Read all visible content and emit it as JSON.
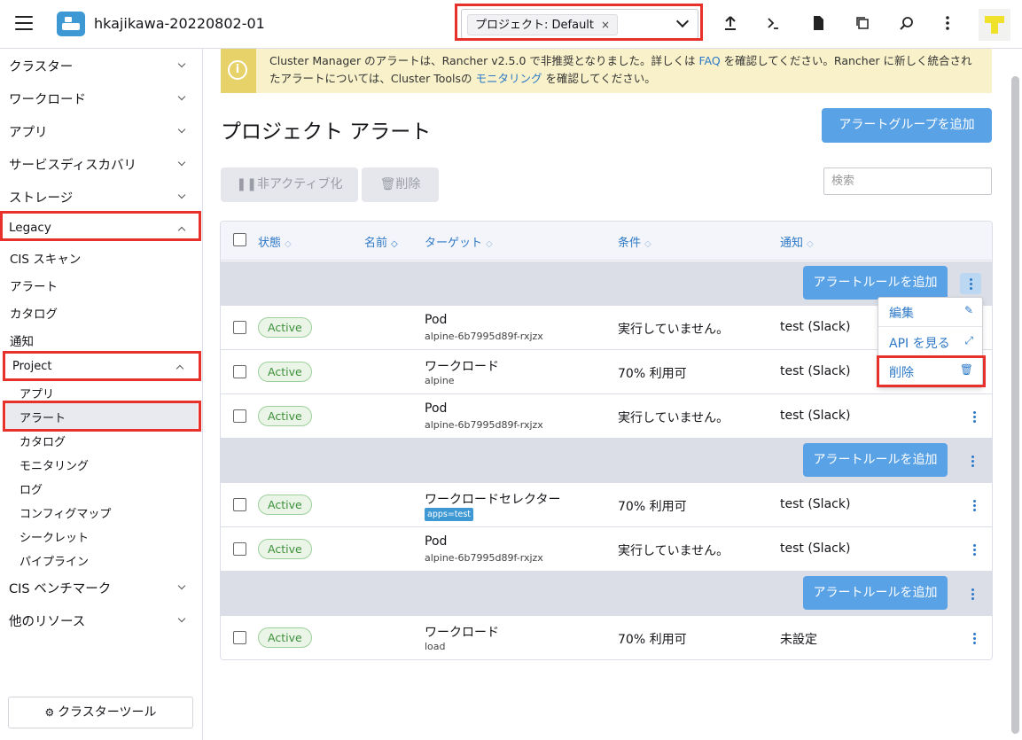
{
  "header": {
    "cluster_name": "hkajikawa-20220802-01",
    "project_chip": "プロジェクト: Default",
    "chip_close": "×"
  },
  "sidebar": {
    "groups": [
      {
        "label": "クラスター",
        "chevron": "down"
      },
      {
        "label": "ワークロード",
        "chevron": "down"
      },
      {
        "label": "アプリ",
        "chevron": "down"
      },
      {
        "label": "サービスディスカバリ",
        "chevron": "down"
      },
      {
        "label": "ストレージ",
        "chevron": "down"
      },
      {
        "label": "Legacy",
        "chevron": "up"
      }
    ],
    "legacy_items": [
      "CIS スキャン",
      "アラート",
      "カタログ",
      "通知"
    ],
    "project_label": "Project",
    "project_items": [
      "アプリ",
      "アラート",
      "カタログ",
      "モニタリング",
      "ログ",
      "コンフィグマップ",
      "シークレット",
      "パイプライン"
    ],
    "bottom_groups": [
      "CIS ベンチマーク",
      "他のリソース"
    ],
    "cluster_tool_button": "クラスターツール"
  },
  "banner": {
    "icon": "i",
    "text_1": "Cluster Manager のアラートは、Rancher v2.5.0 で非推奨となりました。詳しくは ",
    "link_faq": "FAQ",
    "text_2": " を確認してください。Rancher に新しく統合されたアラートについては、Cluster Toolsの ",
    "link_monitoring": "モニタリング",
    "text_3": " を確認してください。"
  },
  "main": {
    "title": "プロジェクト アラート",
    "add_group_button": "アラートグループを追加",
    "deactivate_button": "非アクティブ化",
    "delete_button": "削除",
    "search_placeholder": "検索"
  },
  "table": {
    "headers": [
      "状態",
      "名前",
      "ターゲット",
      "条件",
      "通知"
    ],
    "add_rule_button": "アラートルールを追加",
    "rows": [
      {
        "state": "Active",
        "target": "Pod",
        "target_sub": "alpine-6b7995d89f-rxjzx",
        "condition": "実行していません。",
        "notification": "test (Slack)"
      },
      {
        "state": "Active",
        "target": "ワークロード",
        "target_sub": "alpine",
        "condition": "70% 利用可",
        "notification": "test (Slack)"
      },
      {
        "state": "Active",
        "target": "Pod",
        "target_sub": "alpine-6b7995d89f-rxjzx",
        "condition": "実行していません。",
        "notification": "test (Slack)"
      },
      {
        "state": "Active",
        "target": "ワークロードセレクター",
        "target_tag": "apps=test",
        "condition": "70% 利用可",
        "notification": "test (Slack)"
      },
      {
        "state": "Active",
        "target": "Pod",
        "target_sub": "alpine-6b7995d89f-rxjzx",
        "condition": "実行していません。",
        "notification": "test (Slack)"
      },
      {
        "state": "Active",
        "target": "ワークロード",
        "target_sub": "load",
        "condition": "70% 利用可",
        "notification": "未設定"
      }
    ]
  },
  "dropdown": {
    "items": [
      "編集",
      "API を見る",
      "削除"
    ]
  },
  "colors": {
    "accent": "#5aa2e6",
    "highlight_box": "#e8312a",
    "banner_bg": "#f8f1c9",
    "active_badge": "#3d8f3a"
  }
}
